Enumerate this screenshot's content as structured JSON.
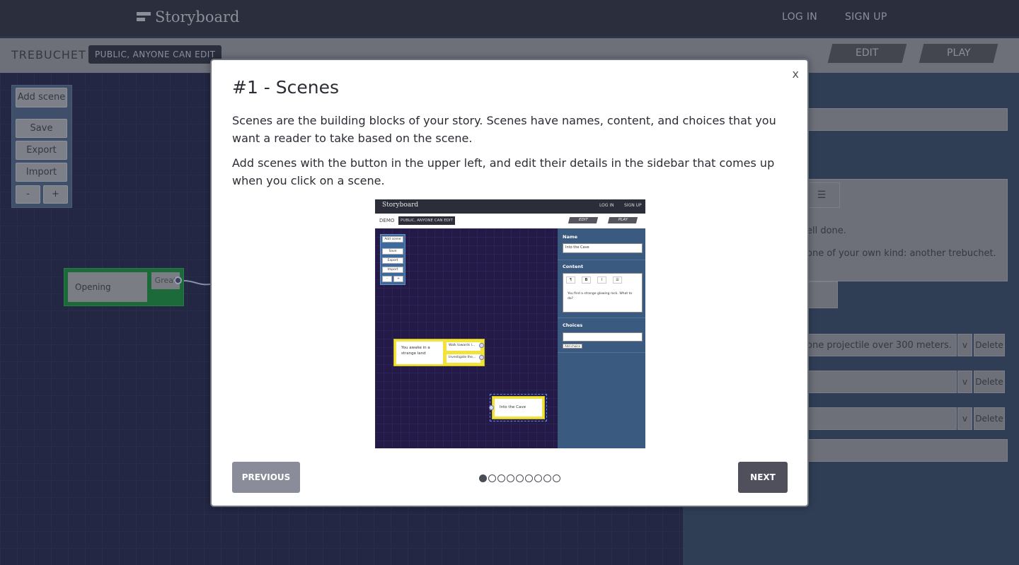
{
  "app": {
    "logo_text": "Storyboard",
    "login_label": "LOG IN",
    "signup_label": "SIGN UP"
  },
  "story": {
    "title": "TREBUCHET",
    "visibility": "PUBLIC, ANYONE CAN EDIT",
    "edit_label": "EDIT",
    "play_label": "PLAY"
  },
  "toolbar": {
    "add_scene": "Add scene",
    "save": "Save",
    "export": "Export",
    "import": "Import",
    "zoom_out": "-",
    "zoom_in": "+"
  },
  "canvas": {
    "node_name": "Opening",
    "node_choice": "Great"
  },
  "sidebar": {
    "content_line1": "ell done.",
    "content_line2": "one of your own kind: another trebuchet.",
    "choice1_text": "one projectile over 300 meters.",
    "choice_toggle": "v",
    "delete_label": "Delete"
  },
  "modal": {
    "close": "x",
    "title": "#1 - Scenes",
    "paragraph1": "Scenes are the building blocks of your story. Scenes have names, content, and choices that you want a reader to take based on the scene.",
    "paragraph2": "Add scenes with the button in the upper left, and edit their details in the sidebar that comes up when you click on a scene.",
    "previous_label": "PREVIOUS",
    "next_label": "NEXT",
    "total_steps": 9,
    "current_step": 1
  },
  "tutorial_image": {
    "logo": "Storyboard",
    "login": "LOG IN",
    "signup": "SIGN UP",
    "story_title": "DEMO",
    "visibility": "PUBLIC, ANYONE CAN EDIT",
    "edit": "EDIT",
    "play": "PLAY",
    "add_scene": "Add scene",
    "save": "Save",
    "export": "Export",
    "import": "Import",
    "minus": "-",
    "plus": "+",
    "scene1_text": "You awake in a strange land",
    "scene1_choice1": "Walk towards l...",
    "scene1_choice2": "Investigate the...",
    "scene2_text": "Into the Cave",
    "name_label": "Name",
    "name_value": "Into the Cave",
    "content_label": "Content",
    "fmt_p": "¶",
    "fmt_b": "B",
    "fmt_i": "I",
    "fmt_list": "☰",
    "content_value": "You find a strange glowing rock. What to do?",
    "choices_label": "Choices",
    "add_choice": "Add choice"
  }
}
